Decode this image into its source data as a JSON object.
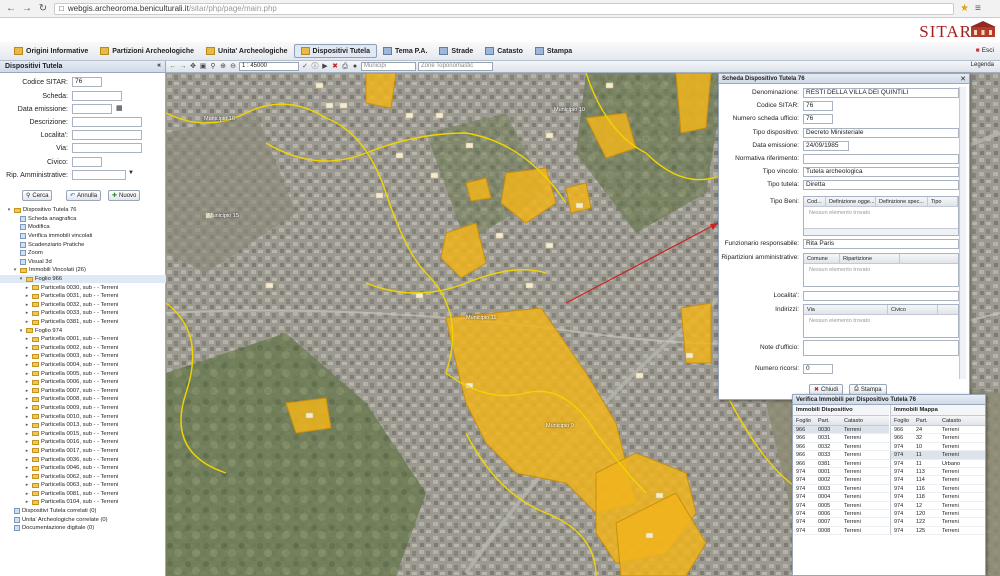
{
  "browser": {
    "url_host": "webgis.archeoroma.beniculturali.it",
    "url_path": "/sitar/php/page/main.php"
  },
  "brand": {
    "title": "SITAR"
  },
  "tabs": [
    {
      "label": "Origini Informative",
      "active": false
    },
    {
      "label": "Partizioni Archeologiche",
      "active": false
    },
    {
      "label": "Unita' Archeologiche",
      "active": false
    },
    {
      "label": "Dispositivi Tutela",
      "active": true
    },
    {
      "label": "Tema P.A.",
      "active": false
    },
    {
      "label": "Strade",
      "active": false
    },
    {
      "label": "Catasto",
      "active": false
    },
    {
      "label": "Stampa",
      "active": false
    }
  ],
  "esci": "Esci",
  "left_panel": {
    "title": "Dispositivi Tutela",
    "fields": [
      {
        "label": "Codice SITAR:",
        "value": "76"
      },
      {
        "label": "Scheda:",
        "value": ""
      },
      {
        "label": "Data emissione:",
        "value": ""
      },
      {
        "label": "Descrizione:",
        "value": ""
      },
      {
        "label": "Localita':",
        "value": ""
      },
      {
        "label": "Via:",
        "value": ""
      },
      {
        "label": "Civico:",
        "value": ""
      },
      {
        "label": "Rip. Amministrative:",
        "value": ""
      }
    ],
    "buttons": [
      "Cerca",
      "Annulla",
      "Nuovo"
    ],
    "tree": [
      {
        "level": 0,
        "icon": "f",
        "label": "Dispositivo Tutela 76"
      },
      {
        "level": 1,
        "icon": "d",
        "label": "Scheda anagrafica"
      },
      {
        "level": 1,
        "icon": "d",
        "label": "Modifica"
      },
      {
        "level": 1,
        "icon": "d",
        "label": "Verifica immobili vincolati"
      },
      {
        "level": 1,
        "icon": "d",
        "label": "Scadenziario Pratiche"
      },
      {
        "level": 1,
        "icon": "d",
        "label": "Zoom"
      },
      {
        "level": 1,
        "icon": "d",
        "label": "Visual 3d"
      },
      {
        "level": 1,
        "icon": "f",
        "label": "Immobili Vincolati (26)"
      },
      {
        "level": 2,
        "icon": "f",
        "label": "Foglio 966",
        "sel": true
      },
      {
        "level": 3,
        "icon": "f",
        "label": "Particella 0030, sub - - Terreni"
      },
      {
        "level": 3,
        "icon": "f",
        "label": "Particella 0031, sub - - Terreni"
      },
      {
        "level": 3,
        "icon": "f",
        "label": "Particella 0032, sub - - Terreni"
      },
      {
        "level": 3,
        "icon": "f",
        "label": "Particella 0033, sub - - Terreni"
      },
      {
        "level": 3,
        "icon": "f",
        "label": "Particella 0381, sub - - Terreni"
      },
      {
        "level": 2,
        "icon": "f",
        "label": "Foglio 974"
      },
      {
        "level": 3,
        "icon": "f",
        "label": "Particella 0001, sub - - Terreni"
      },
      {
        "level": 3,
        "icon": "f",
        "label": "Particella 0002, sub - - Terreni"
      },
      {
        "level": 3,
        "icon": "f",
        "label": "Particella 0003, sub - - Terreni"
      },
      {
        "level": 3,
        "icon": "f",
        "label": "Particella 0004, sub - - Terreni"
      },
      {
        "level": 3,
        "icon": "f",
        "label": "Particella 0005, sub - - Terreni"
      },
      {
        "level": 3,
        "icon": "f",
        "label": "Particella 0006, sub - - Terreni"
      },
      {
        "level": 3,
        "icon": "f",
        "label": "Particella 0007, sub - - Terreni"
      },
      {
        "level": 3,
        "icon": "f",
        "label": "Particella 0008, sub - - Terreni"
      },
      {
        "level": 3,
        "icon": "f",
        "label": "Particella 0009, sub - - Terreni"
      },
      {
        "level": 3,
        "icon": "f",
        "label": "Particella 0010, sub - - Terreni"
      },
      {
        "level": 3,
        "icon": "f",
        "label": "Particella 0013, sub - - Terreni"
      },
      {
        "level": 3,
        "icon": "f",
        "label": "Particella 0015, sub - - Terreni"
      },
      {
        "level": 3,
        "icon": "f",
        "label": "Particella 0016, sub - - Terreni"
      },
      {
        "level": 3,
        "icon": "f",
        "label": "Particella 0017, sub - - Terreni"
      },
      {
        "level": 3,
        "icon": "f",
        "label": "Particella 0036, sub - - Terreni"
      },
      {
        "level": 3,
        "icon": "f",
        "label": "Particella 0046, sub - - Terreni"
      },
      {
        "level": 3,
        "icon": "f",
        "label": "Particella 0062, sub - - Terreni"
      },
      {
        "level": 3,
        "icon": "f",
        "label": "Particella 0063, sub - - Terreni"
      },
      {
        "level": 3,
        "icon": "f",
        "label": "Particella 0081, sub - - Terreni"
      },
      {
        "level": 3,
        "icon": "f",
        "label": "Particella 0104, sub - - Terreni"
      },
      {
        "level": 0,
        "icon": "d",
        "label": "Dispositivi Tutela correlati (0)"
      },
      {
        "level": 0,
        "icon": "d",
        "label": "Unita' Archeologiche correlate (0)"
      },
      {
        "level": 0,
        "icon": "d",
        "label": "Documentazione digitale (0)"
      }
    ]
  },
  "map_toolbar": {
    "scale": "1 : 45000",
    "municipi": "Municipi",
    "zone": "Zone Toponomastic",
    "legenda": "Legenda"
  },
  "map_labels": [
    "Municipio 16",
    "Municipio 15",
    "Municipio 11",
    "Municipio 10",
    "Municipio 12",
    "Municipio 9"
  ],
  "scheda": {
    "title": "Scheda Dispositivo Tutela 76",
    "fields": [
      {
        "label": "Denominazione:",
        "value": "RESTI DELLA VILLA DEI QUINTILI"
      },
      {
        "label": "Codice SITAR:",
        "value": "76"
      },
      {
        "label": "Numero scheda ufficio:",
        "value": "76"
      },
      {
        "label": "Tipo dispositivo:",
        "value": "Decreto Ministeriale"
      },
      {
        "label": "Data emissione:",
        "value": "24/09/1985"
      },
      {
        "label": "Normativa riferimento:",
        "value": ""
      },
      {
        "label": "Tipo vincolo:",
        "value": "Tutela archeologica"
      },
      {
        "label": "Tipo tutela:",
        "value": "Diretta"
      }
    ],
    "tipo_beni_label": "Tipo Beni:",
    "tipo_beni_cols": [
      "Cod...",
      "Definizione ogge...",
      "Definizione spec...",
      "Tipo"
    ],
    "empty": "Nessun elemento trovato",
    "funzionario_label": "Funzionario responsabile:",
    "funzionario_value": "Rita Paris",
    "ripartizioni_label": "Ripartizioni amministrative:",
    "ripartizioni_cols": [
      "Comune",
      "Ripartizione"
    ],
    "localita_label": "Localita':",
    "indirizzi_label": "Indirizzi:",
    "indirizzi_cols": [
      "Via",
      "Civico"
    ],
    "note_label": "Note d'ufficio:",
    "ricorsi_label": "Numero ricorsi:",
    "ricorsi_value": "0",
    "buttons": [
      "Chiudi",
      "Stampa"
    ]
  },
  "verifica": {
    "title": "Verifica Immobili per Dispositivo Tutela 76",
    "left_title": "Immobili Dispositivo",
    "right_title": "Immobili Mappa",
    "cols": [
      "Foglio",
      "Part.",
      "Catasto"
    ],
    "left_rows": [
      [
        "966",
        "0030",
        "Terreni"
      ],
      [
        "966",
        "0031",
        "Terreni"
      ],
      [
        "966",
        "0032",
        "Terreni"
      ],
      [
        "966",
        "0033",
        "Terreni"
      ],
      [
        "966",
        "0381",
        "Terreni"
      ],
      [
        "974",
        "0001",
        "Terreni"
      ],
      [
        "974",
        "0002",
        "Terreni"
      ],
      [
        "974",
        "0003",
        "Terreni"
      ],
      [
        "974",
        "0004",
        "Terreni"
      ],
      [
        "974",
        "0005",
        "Terreni"
      ],
      [
        "974",
        "0006",
        "Terreni"
      ],
      [
        "974",
        "0007",
        "Terreni"
      ],
      [
        "974",
        "0008",
        "Terreni"
      ]
    ],
    "right_rows": [
      [
        "966",
        "24",
        "Terreni"
      ],
      [
        "966",
        "32",
        "Terreni"
      ],
      [
        "974",
        "10",
        "Terreni"
      ],
      [
        "974",
        "11",
        "Terreni"
      ],
      [
        "974",
        "11",
        "Urbano"
      ],
      [
        "974",
        "113",
        "Terreni"
      ],
      [
        "974",
        "114",
        "Terreni"
      ],
      [
        "974",
        "116",
        "Terreni"
      ],
      [
        "974",
        "118",
        "Terreni"
      ],
      [
        "974",
        "12",
        "Terreni"
      ],
      [
        "974",
        "120",
        "Terreni"
      ],
      [
        "974",
        "122",
        "Terreni"
      ],
      [
        "974",
        "125",
        "Terreni"
      ]
    ]
  }
}
